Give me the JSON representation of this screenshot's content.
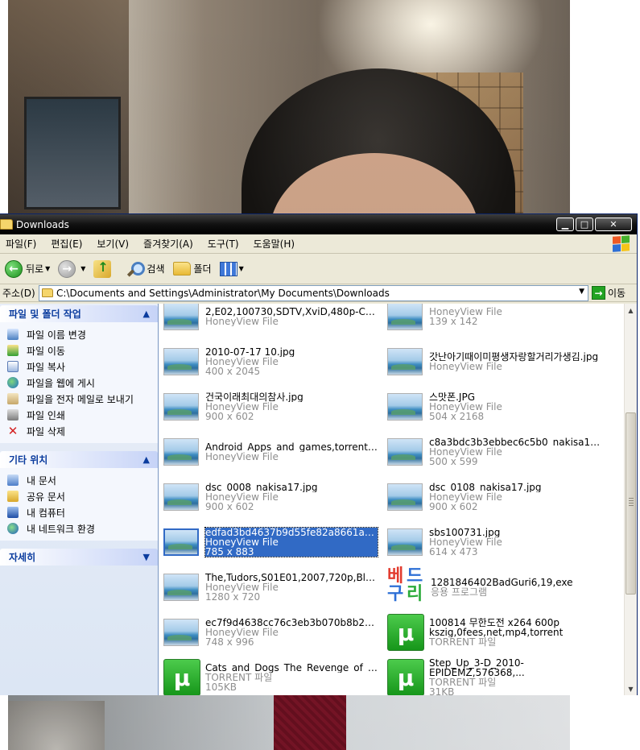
{
  "window": {
    "title": "Downloads",
    "min_label": "▁",
    "max_label": "□",
    "close_label": "✕"
  },
  "menu": [
    "파일(F)",
    "편집(E)",
    "보기(V)",
    "즐겨찾기(A)",
    "도구(T)",
    "도움말(H)"
  ],
  "toolbar": {
    "back": "뒤로",
    "search": "검색",
    "folders": "폴더"
  },
  "address": {
    "label": "주소(D)",
    "path": "C:\\Documents and Settings\\Administrator\\My Documents\\Downloads",
    "go": "이동"
  },
  "tasks": {
    "file_tasks_title": "파일 및 폴더 작업",
    "file_tasks": [
      "파일 이름 변경",
      "파일 이동",
      "파일 복사",
      "파일을 웹에 게시",
      "파일을 전자 메일로 보내기",
      "파일 인쇄",
      "파일 삭제"
    ],
    "other_places_title": "기타 위치",
    "other_places": [
      "내 문서",
      "공유 문서",
      "내 컴퓨터",
      "내 네트워크 환경"
    ],
    "details_title": "자세히"
  },
  "files": [
    {
      "name": "2,E02,100730,SDTV,XviD,480p-Chad,...",
      "type": "HoneyView File",
      "size": "",
      "icon": "image"
    },
    {
      "name": "",
      "type": "HoneyView File",
      "size": "139 x 142",
      "icon": "image"
    },
    {
      "name": "2010-07-17 10.jpg",
      "type": "HoneyView File",
      "size": "400 x 2045",
      "icon": "image"
    },
    {
      "name": "갓난아기때이미평생자랑할거리가생김.jpg",
      "type": "HoneyView File",
      "size": "",
      "icon": "image"
    },
    {
      "name": "건국이래최대의참사.jpg",
      "type": "HoneyView File",
      "size": "900 x 602",
      "icon": "image"
    },
    {
      "name": "스맛폰.JPG",
      "type": "HoneyView File",
      "size": "504 x 2168",
      "icon": "image"
    },
    {
      "name": "Android_Apps_and_games,torrent.jpg",
      "type": "HoneyView File",
      "size": "",
      "icon": "image"
    },
    {
      "name": "c8a3bdc3b3ebbec6c5b0_nakisa17.jpg",
      "type": "HoneyView File",
      "size": "500 x 599",
      "icon": "image"
    },
    {
      "name": "dsc_0008_nakisa17.jpg",
      "type": "HoneyView File",
      "size": "900 x 602",
      "icon": "image"
    },
    {
      "name": "dsc_0108_nakisa17.jpg",
      "type": "HoneyView File",
      "size": "900 x 602",
      "icon": "image"
    },
    {
      "name": "edfad3bd4637b9d55fe82a8661aeba83,...",
      "type": "HoneyView File",
      "size": "785 x 883",
      "icon": "image",
      "selected": true
    },
    {
      "name": "sbs100731.jpg",
      "type": "HoneyView File",
      "size": "614 x 473",
      "icon": "image"
    },
    {
      "name": "The,Tudors,S01E01,2007,720p,BluRa,...",
      "type": "HoneyView File",
      "size": "1280 x 720",
      "icon": "image"
    },
    {
      "name": "1281846402BadGuri6,19,exe",
      "type": "응용 프로그램",
      "size": "",
      "icon": "exe"
    },
    {
      "name": "ec7f9d4638cc76c3eb3b070b8b271792,...",
      "type": "HoneyView File",
      "size": "748 x 996",
      "icon": "image"
    },
    {
      "name": "100814 무한도전 x264 600p kszig,0fees,net,mp4,torrent",
      "type": "TORRENT 파일",
      "size": "",
      "icon": "torrent"
    },
    {
      "name": "Cats_and_Dogs_The_Revenge_of_Ki,...",
      "type": "TORRENT 파일",
      "size": "105KB",
      "icon": "torrent"
    },
    {
      "name": "Step_Up_3-D_2010-EPIDEMZ,576368,...",
      "type": "TORRENT 파일",
      "size": "31KB",
      "icon": "torrent"
    }
  ],
  "icons": {
    "torrent_glyph": "µ",
    "exe_glyphs": [
      "베",
      "드",
      "구",
      "리"
    ]
  },
  "colors": {
    "selection": "#316ac5",
    "taskpane_title": "#0b3c9e"
  }
}
